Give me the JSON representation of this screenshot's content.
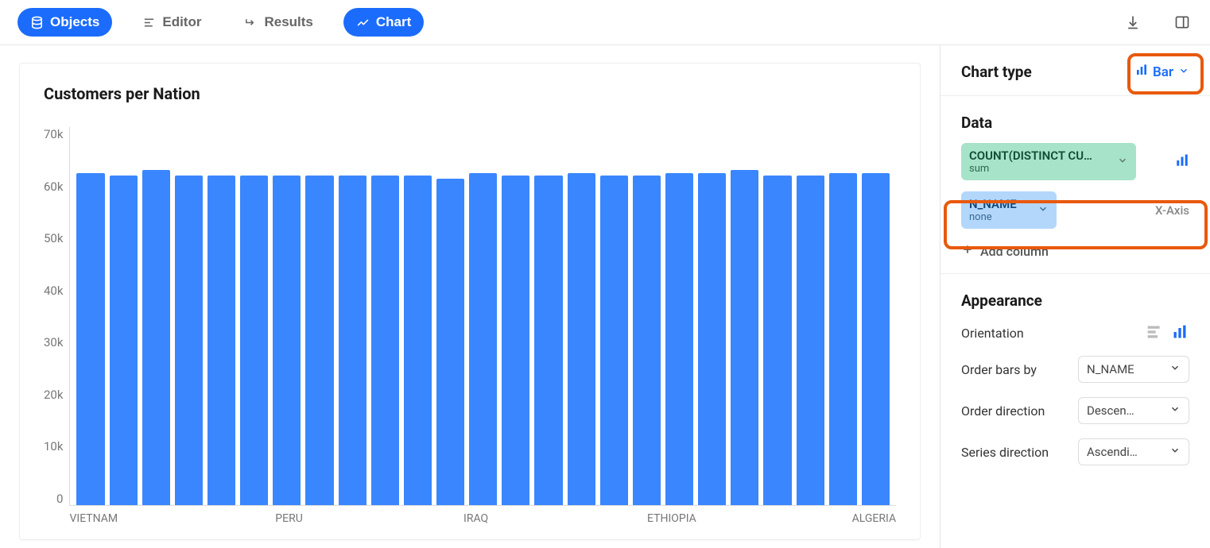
{
  "toolbar": {
    "objects": "Objects",
    "editor": "Editor",
    "results": "Results",
    "chart": "Chart"
  },
  "chart_title": "Customers per Nation",
  "sidebar": {
    "chart_type_label": "Chart type",
    "chart_type_value": "Bar",
    "data_label": "Data",
    "y_pill_main": "COUNT(DISTINCT CU…",
    "y_pill_sub": "sum",
    "x_pill_main": "N_NAME",
    "x_pill_sub": "none",
    "x_axis_hint": "X-Axis",
    "add_column": "Add column",
    "appearance_label": "Appearance",
    "orientation_label": "Orientation",
    "order_bars_label": "Order bars by",
    "order_bars_value": "N_NAME",
    "order_dir_label": "Order direction",
    "order_dir_value": "Descen…",
    "series_dir_label": "Series direction",
    "series_dir_value": "Ascendi…"
  },
  "chart_data": {
    "type": "bar",
    "title": "Customers per Nation",
    "xlabel": "",
    "ylabel": "",
    "ylim": [
      0,
      70000
    ],
    "y_ticks": [
      "70k",
      "60k",
      "50k",
      "40k",
      "30k",
      "20k",
      "10k",
      "0"
    ],
    "x_tick_labels": [
      "VIETNAM",
      "PERU",
      "IRAQ",
      "ETHIOPIA",
      "ALGERIA"
    ],
    "x_tick_positions": [
      0,
      6,
      12,
      18,
      24
    ],
    "categories": [
      "VIETNAM",
      "",
      "",
      "",
      "",
      "",
      "PERU",
      "",
      "",
      "",
      "",
      "",
      "IRAQ",
      "",
      "",
      "",
      "",
      "",
      "ETHIOPIA",
      "",
      "",
      "",
      "",
      "",
      "ALGERIA"
    ],
    "values": [
      61500,
      61000,
      62000,
      61000,
      61000,
      61000,
      61000,
      61000,
      61000,
      61000,
      61000,
      60500,
      61500,
      61000,
      61000,
      61500,
      61000,
      61000,
      61500,
      61500,
      62000,
      61000,
      61000,
      61500,
      61500
    ]
  }
}
